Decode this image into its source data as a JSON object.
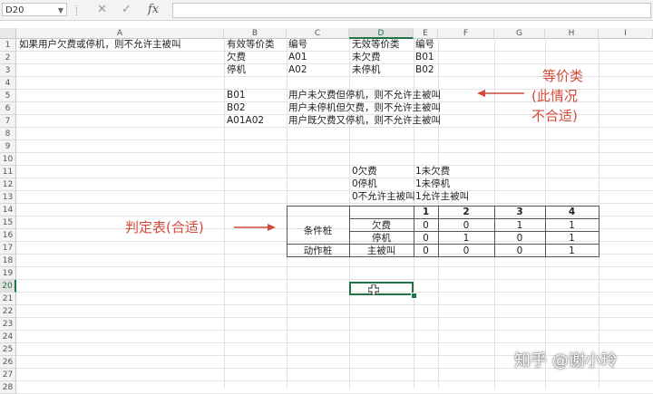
{
  "formula_bar": {
    "name_box": "D20",
    "fx_label": "fx",
    "cancel_glyph": "✕",
    "enter_glyph": "✓",
    "formula_value": ""
  },
  "columns": [
    "A",
    "B",
    "C",
    "D",
    "E",
    "F",
    "G",
    "H",
    "I"
  ],
  "rows": [
    "1",
    "2",
    "3",
    "4",
    "5",
    "6",
    "7",
    "8",
    "9",
    "10",
    "11",
    "12",
    "13",
    "14",
    "15",
    "16",
    "17",
    "18",
    "19",
    "20",
    "21",
    "22",
    "23",
    "24",
    "25",
    "26",
    "27",
    "28"
  ],
  "active_row": "20",
  "active_col": "D",
  "cells": {
    "a1": "如果用户欠费或停机，则不允许主被叫",
    "b1": "有效等价类",
    "c1": "编号",
    "d1": "无效等价类",
    "e1": "编号",
    "b2": "欠费",
    "c2": "A01",
    "d2": "未欠费",
    "e2": "B01",
    "b3": "停机",
    "c3": "A02",
    "d3": "未停机",
    "e3": "B02",
    "b5": "B01",
    "c5": "用户未欠费但停机，则不允许主被叫",
    "b6": "B02",
    "c6": "用户未停机但欠费，则不允许主被叫",
    "b7": "A01A02",
    "c7": "用户既欠费又停机，则不允许主被叫",
    "d11": "0欠费",
    "e11": "1未欠费",
    "d12": "0停机",
    "e12": "1未停机",
    "d13": "0不允许主被叫",
    "e13": "1允许主被叫"
  },
  "decision_table": {
    "rules": [
      "1",
      "2",
      "3",
      "4"
    ],
    "condition_label": "条件桩",
    "action_label": "动作桩",
    "rows": [
      {
        "name": "欠费",
        "values": [
          "0",
          "0",
          "1",
          "1"
        ]
      },
      {
        "name": "停机",
        "values": [
          "0",
          "1",
          "0",
          "1"
        ]
      },
      {
        "name": "主被叫",
        "values": [
          "0",
          "0",
          "0",
          "1"
        ]
      }
    ]
  },
  "annotations": {
    "equiv_line1": "等价类",
    "equiv_line2": "(此情况",
    "equiv_line3": "不合适)",
    "decision": "判定表(合适)",
    "color": "#d44a3a"
  },
  "watermark": "知乎 @谢小玲"
}
